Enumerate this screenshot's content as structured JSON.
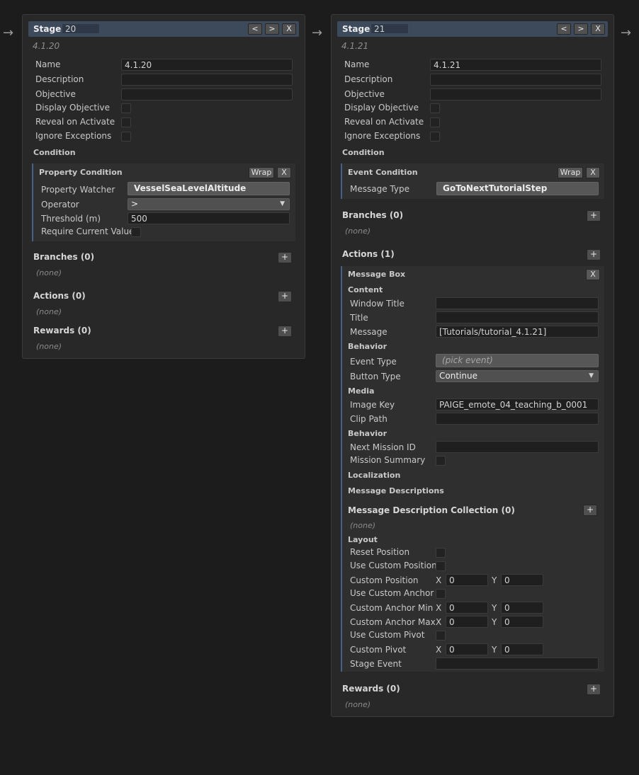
{
  "labels": {
    "stage": "Stage",
    "name": "Name",
    "description": "Description",
    "objective": "Objective",
    "display_objective": "Display Objective",
    "reveal_on_activate": "Reveal on Activate",
    "ignore_exceptions": "Ignore Exceptions",
    "condition": "Condition",
    "wrap": "Wrap",
    "remove": "X",
    "prev": "<",
    "next": ">",
    "add": "+",
    "none": "(none)"
  },
  "stage1": {
    "number": "20",
    "id": "4.1.20",
    "name": "4.1.20",
    "description": "",
    "objective": "",
    "condition": {
      "title": "Property Condition",
      "property_watcher_label": "Property Watcher",
      "property_watcher": "VesselSeaLevelAltitude",
      "operator_label": "Operator",
      "operator": ">",
      "threshold_label": "Threshold (m)",
      "threshold": "500",
      "require_current_label": "Require Current Value"
    },
    "branches": "Branches (0)",
    "actions": "Actions (0)",
    "rewards": "Rewards (0)"
  },
  "stage2": {
    "number": "21",
    "id": "4.1.21",
    "name": "4.1.21",
    "description": "",
    "objective": "",
    "condition": {
      "title": "Event Condition",
      "message_type_label": "Message Type",
      "message_type": "GoToNextTutorialStep"
    },
    "branches": "Branches (0)",
    "actions": "Actions (1)",
    "message_box": {
      "title": "Message Box",
      "content": "Content",
      "window_title_label": "Window Title",
      "window_title": "",
      "title_label": "Title",
      "title_value": "",
      "message_label": "Message",
      "message": "[Tutorials/tutorial_4.1.21]",
      "behavior": "Behavior",
      "event_type_label": "Event Type",
      "event_type_placeholder": "(pick event)",
      "button_type_label": "Button Type",
      "button_type": "Continue",
      "media": "Media",
      "image_key_label": "Image Key",
      "image_key": "PAIGE_emote_04_teaching_b_0001",
      "clip_path_label": "Clip Path",
      "clip_path": "",
      "behavior2": "Behavior",
      "next_mission_label": "Next Mission ID",
      "next_mission": "",
      "mission_summary_label": "Mission Summary",
      "localization": "Localization",
      "message_descriptions": "Message Descriptions",
      "collection": "Message Description Collection (0)",
      "layout": "Layout",
      "reset_position_label": "Reset Position",
      "use_custom_position_label": "Use Custom Position",
      "custom_position_label": "Custom Position",
      "use_custom_anchor_label": "Use Custom Anchor",
      "custom_anchor_min_label": "Custom Anchor Min",
      "custom_anchor_max_label": "Custom Anchor Max",
      "use_custom_pivot_label": "Use Custom Pivot",
      "custom_pivot_label": "Custom Pivot",
      "stage_event_label": "Stage Event",
      "stage_event": "",
      "x_label": "X",
      "y_label": "Y",
      "custom_position": {
        "x": "0",
        "y": "0"
      },
      "custom_anchor_min": {
        "x": "0",
        "y": "0"
      },
      "custom_anchor_max": {
        "x": "0",
        "y": "0"
      },
      "custom_pivot": {
        "x": "0",
        "y": "0"
      }
    },
    "rewards": "Rewards (0)"
  },
  "icons": {
    "arrow": "arrow-right-icon"
  }
}
